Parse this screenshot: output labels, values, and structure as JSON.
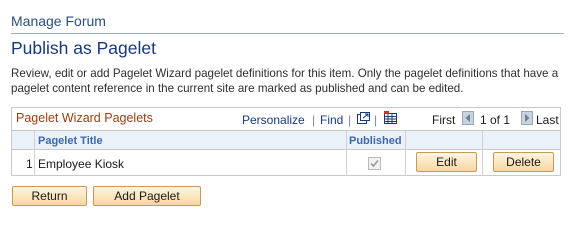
{
  "breadcrumb": "Manage Forum",
  "page_title": "Publish as Pagelet",
  "description": "Review, edit or add Pagelet Wizard pagelet definitions for this item.  Only the pagelet definitions that have a pagelet content reference in the current site are marked as published and can be edited.",
  "grid": {
    "title": "Pagelet Wizard Pagelets",
    "personalize": "Personalize",
    "find": "Find",
    "first": "First",
    "paging": "1 of 1",
    "last": "Last",
    "separator": "|",
    "columns": {
      "title": "Pagelet Title",
      "published": "Published"
    },
    "rows": [
      {
        "number": "1",
        "title": "Employee Kiosk",
        "published": true,
        "edit": "Edit",
        "delete": "Delete"
      }
    ]
  },
  "buttons": {
    "return": "Return",
    "add": "Add Pagelet"
  },
  "icons": [
    "view-all-icon",
    "download-grid-icon",
    "prev-arrow-icon",
    "next-arrow-icon",
    "checkbox-icon"
  ],
  "colors": {
    "title_blue": "#17397d",
    "grid_title": "#9a3f10",
    "column_header_bg": "#ebf1f8",
    "button_bg": "#f6d7a0"
  }
}
